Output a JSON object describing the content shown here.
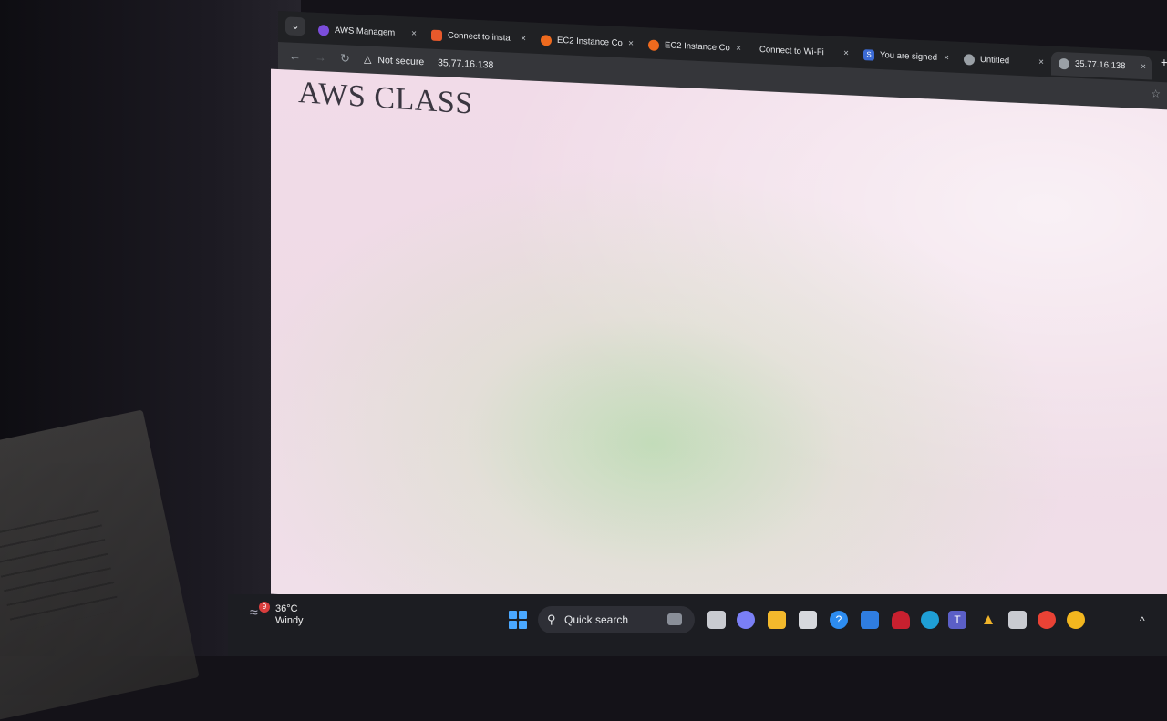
{
  "browser": {
    "tabs": [
      {
        "label": "AWS Managem",
        "favicon_color": "#7b4ddb"
      },
      {
        "label": "Connect to insta",
        "favicon_color": "#e8592b"
      },
      {
        "label": "EC2 Instance Co",
        "favicon_color": "#ee6a1e"
      },
      {
        "label": "EC2 Instance Co",
        "favicon_color": "#ee6a1e"
      },
      {
        "label": "Connect to Wi-Fi",
        "favicon_color": ""
      },
      {
        "label": "You are signed",
        "favicon_color": "#3b6ad4",
        "favicon_text": "S"
      },
      {
        "label": "Untitled",
        "favicon_color": "#9aa0a6"
      },
      {
        "label": "35.77.16.138",
        "favicon_color": "#9aa0a6"
      }
    ],
    "active_tab_index": 7,
    "close_glyph": "×",
    "new_tab_glyph": "+",
    "address_bar": {
      "security_label": "Not secure",
      "url": "35.77.16.138"
    }
  },
  "page": {
    "title": "AWS CLASS"
  },
  "taskbar": {
    "weather": {
      "badge": "9",
      "temperature": "36°C",
      "condition": "Windy"
    },
    "search_label": "Quick search",
    "apps": [
      {
        "name": "task-view-icon",
        "color": "#c9cbd1"
      },
      {
        "name": "copilot-icon",
        "color": "#7a7ff5"
      },
      {
        "name": "file-explorer-icon",
        "color": "#f3b92c"
      },
      {
        "name": "store-icon",
        "color": "#d6d8dd"
      },
      {
        "name": "help-icon",
        "color": "#2d8cf0"
      },
      {
        "name": "tcs-app-icon",
        "color": "#2f7de1"
      },
      {
        "name": "mcafee-icon",
        "color": "#c8202f"
      },
      {
        "name": "edge-icon",
        "color": "#1f9fd6"
      },
      {
        "name": "teams-icon",
        "color": "#5b5fc7"
      },
      {
        "name": "warning-app-icon",
        "color": "#f0b42a"
      },
      {
        "name": "puzzle-app-icon",
        "color": "#c9cbd1"
      },
      {
        "name": "chrome-icon",
        "color": "#e94235"
      },
      {
        "name": "chrome-canary-icon",
        "color": "#f2b61f"
      }
    ],
    "tray_glyph": "^"
  }
}
